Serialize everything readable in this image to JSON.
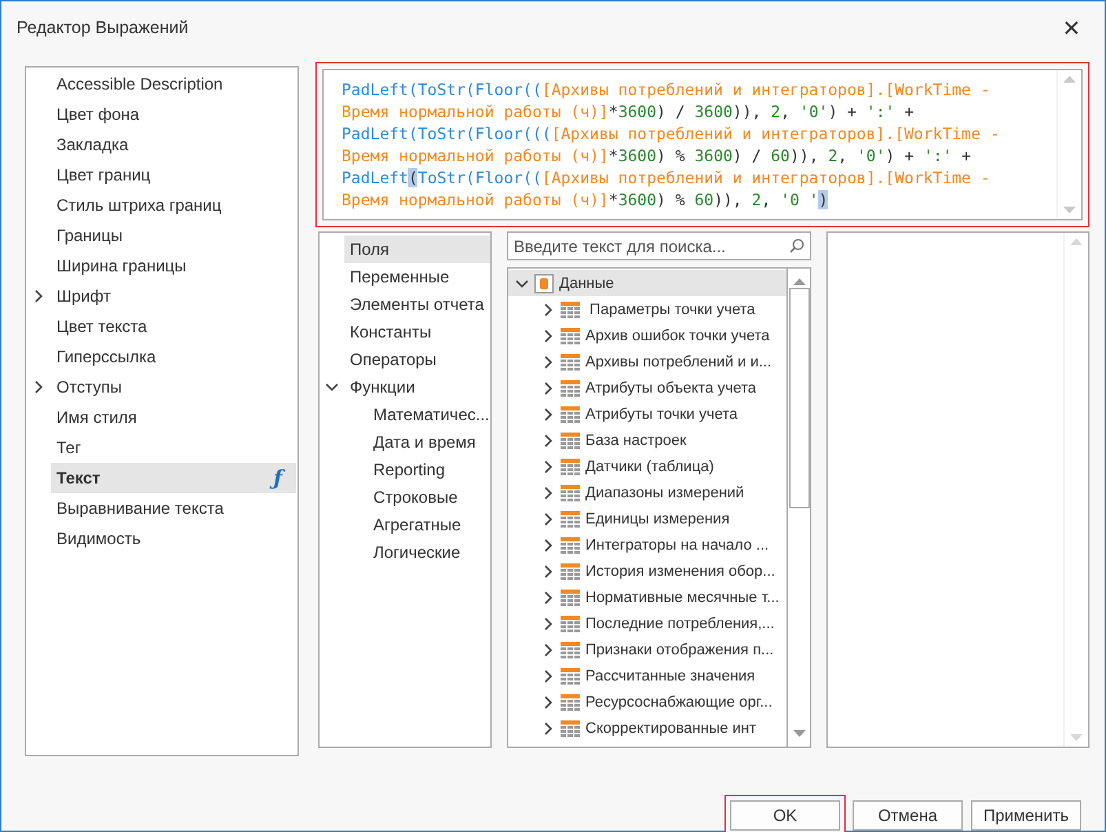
{
  "window": {
    "title": "Редактор Выражений",
    "close": "✕"
  },
  "properties": [
    {
      "label": "Accessible Description",
      "expandable": false,
      "selected": false
    },
    {
      "label": "Цвет фона",
      "expandable": false,
      "selected": false
    },
    {
      "label": "Закладка",
      "expandable": false,
      "selected": false
    },
    {
      "label": "Цвет границ",
      "expandable": false,
      "selected": false
    },
    {
      "label": "Стиль штриха границ",
      "expandable": false,
      "selected": false
    },
    {
      "label": "Границы",
      "expandable": false,
      "selected": false
    },
    {
      "label": "Ширина границы",
      "expandable": false,
      "selected": false
    },
    {
      "label": "Шрифт",
      "expandable": true,
      "selected": false
    },
    {
      "label": "Цвет текста",
      "expandable": false,
      "selected": false
    },
    {
      "label": "Гиперссылка",
      "expandable": false,
      "selected": false
    },
    {
      "label": "Отступы",
      "expandable": true,
      "selected": false
    },
    {
      "label": "Имя стиля",
      "expandable": false,
      "selected": false
    },
    {
      "label": "Тег",
      "expandable": false,
      "selected": false
    },
    {
      "label": "Текст",
      "expandable": false,
      "selected": true,
      "badge": "ƒ"
    },
    {
      "label": "Выравнивание текста",
      "expandable": false,
      "selected": false
    },
    {
      "label": "Видимость",
      "expandable": false,
      "selected": false
    }
  ],
  "expression": {
    "lines": [
      [
        {
          "kind": "func",
          "text": "PadLeft(ToStr(Floor(("
        },
        {
          "kind": "field",
          "text": "[Архивы потреблений и интеграторов].[WorkTime -"
        }
      ],
      [
        {
          "kind": "field",
          "text": "Время нормальной работы (ч)]"
        },
        {
          "kind": "plain",
          "text": "*"
        },
        {
          "kind": "num",
          "text": "3600"
        },
        {
          "kind": "plain",
          "text": ") / "
        },
        {
          "kind": "num",
          "text": "3600"
        },
        {
          "kind": "plain",
          "text": ")), "
        },
        {
          "kind": "num",
          "text": "2"
        },
        {
          "kind": "plain",
          "text": ", "
        },
        {
          "kind": "num",
          "text": "'0'"
        },
        {
          "kind": "plain",
          "text": ") + "
        },
        {
          "kind": "num",
          "text": "':'"
        },
        {
          "kind": "plain",
          "text": " +"
        }
      ],
      [
        {
          "kind": "func",
          "text": "PadLeft(ToStr(Floor((("
        },
        {
          "kind": "field",
          "text": "[Архивы потреблений и интеграторов].[WorkTime -"
        }
      ],
      [
        {
          "kind": "field",
          "text": "Время нормальной работы (ч)]"
        },
        {
          "kind": "plain",
          "text": "*"
        },
        {
          "kind": "num",
          "text": "3600"
        },
        {
          "kind": "plain",
          "text": ") % "
        },
        {
          "kind": "num",
          "text": "3600"
        },
        {
          "kind": "plain",
          "text": ") / "
        },
        {
          "kind": "num",
          "text": "60"
        },
        {
          "kind": "plain",
          "text": ")), "
        },
        {
          "kind": "num",
          "text": "2"
        },
        {
          "kind": "plain",
          "text": ", "
        },
        {
          "kind": "num",
          "text": "'0'"
        },
        {
          "kind": "plain",
          "text": ") + "
        },
        {
          "kind": "num",
          "text": "':'"
        },
        {
          "kind": "plain",
          "text": " +"
        }
      ],
      [
        {
          "kind": "func",
          "text": "PadLeft"
        },
        {
          "kind": "match",
          "text": "("
        },
        {
          "kind": "func",
          "text": "ToStr(Floor(("
        },
        {
          "kind": "field",
          "text": "[Архивы потреблений и интеграторов].[WorkTime -"
        }
      ],
      [
        {
          "kind": "field",
          "text": "Время нормальной работы (ч)]"
        },
        {
          "kind": "plain",
          "text": "*"
        },
        {
          "kind": "num",
          "text": "3600"
        },
        {
          "kind": "plain",
          "text": ") % "
        },
        {
          "kind": "num",
          "text": "60"
        },
        {
          "kind": "plain",
          "text": ")), "
        },
        {
          "kind": "num",
          "text": "2"
        },
        {
          "kind": "plain",
          "text": ", "
        },
        {
          "kind": "num",
          "text": "'0 '"
        },
        {
          "kind": "match",
          "text": ")"
        }
      ]
    ]
  },
  "categories": [
    {
      "label": "Поля",
      "selected": true
    },
    {
      "label": "Переменные",
      "selected": false
    },
    {
      "label": "Элементы отчета",
      "selected": false
    },
    {
      "label": "Константы",
      "selected": false
    },
    {
      "label": "Операторы",
      "selected": false
    },
    {
      "label": "Функции",
      "selected": false,
      "expanded": true,
      "children": [
        {
          "label": "Математичес...",
          "selected": false
        },
        {
          "label": "Дата и время",
          "selected": false
        },
        {
          "label": "Reporting",
          "selected": false
        },
        {
          "label": "Строковые",
          "selected": false
        },
        {
          "label": "Агрегатные",
          "selected": false
        },
        {
          "label": "Логические",
          "selected": false
        }
      ]
    }
  ],
  "search": {
    "placeholder": "Введите текст для поиска..."
  },
  "tree": {
    "label": "Данные",
    "expanded": true,
    "selected": true,
    "children": [
      {
        "label": " Параметры точки учета",
        "expanded": false
      },
      {
        "label": "Архив ошибок точки учета",
        "expanded": false
      },
      {
        "label": "Архивы потреблений и и...",
        "expanded": false
      },
      {
        "label": "Атрибуты объекта учета",
        "expanded": false
      },
      {
        "label": "Атрибуты точки учета",
        "expanded": false
      },
      {
        "label": "База настроек",
        "expanded": false
      },
      {
        "label": "Датчики (таблица)",
        "expanded": false
      },
      {
        "label": "Диапазоны измерений",
        "expanded": false
      },
      {
        "label": "Единицы измерения",
        "expanded": false
      },
      {
        "label": "Интеграторы на начало ...",
        "expanded": false
      },
      {
        "label": "История изменения обор...",
        "expanded": false
      },
      {
        "label": "Нормативные месячные т...",
        "expanded": false
      },
      {
        "label": "Последние потребления,...",
        "expanded": false
      },
      {
        "label": "Признаки отображения п...",
        "expanded": false
      },
      {
        "label": "Рассчитанные значения",
        "expanded": false
      },
      {
        "label": "Ресурсоснабжающие орг...",
        "expanded": false
      },
      {
        "label": "Скорректированные инт",
        "expanded": false
      }
    ]
  },
  "buttons": [
    {
      "label": "OK",
      "default": true
    },
    {
      "label": "Отмена",
      "default": false
    },
    {
      "label": "Применить",
      "default": false
    }
  ]
}
